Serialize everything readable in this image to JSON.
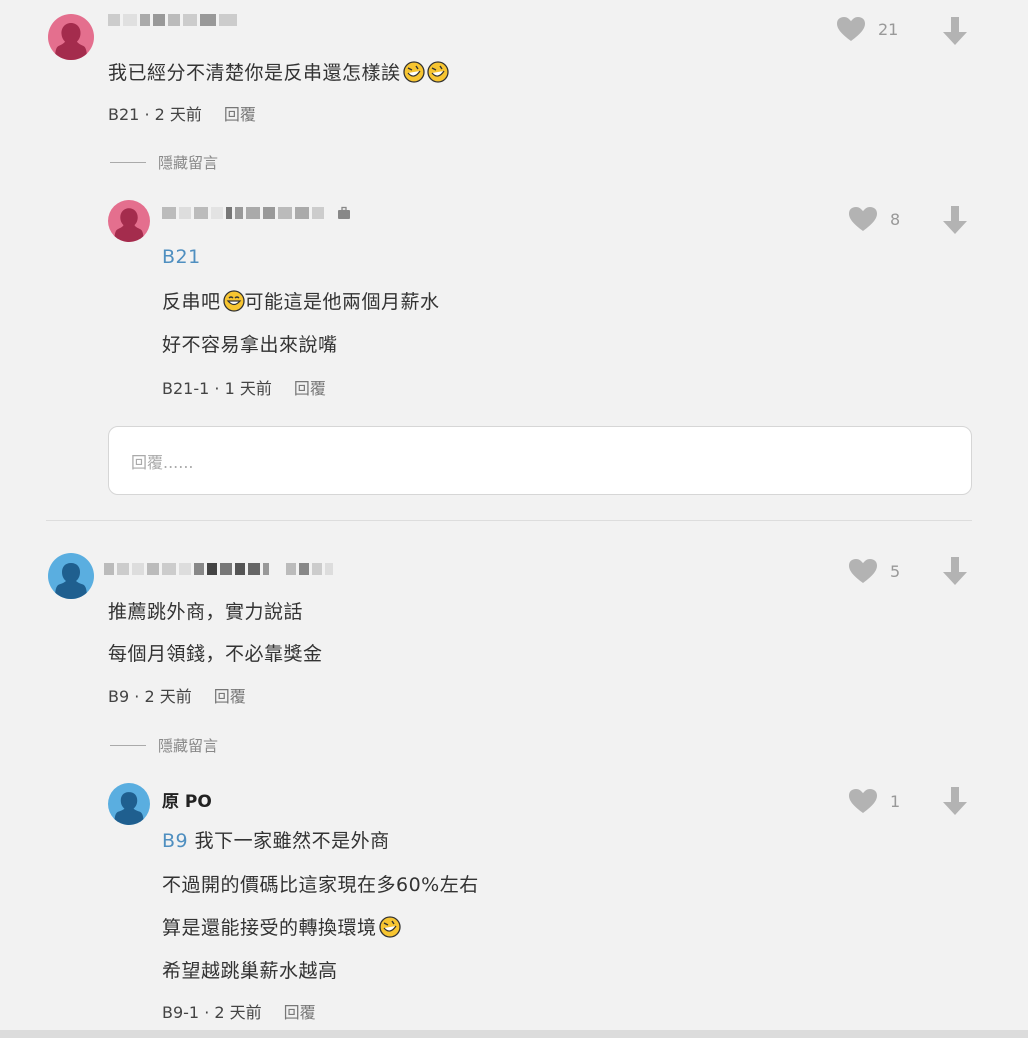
{
  "comments": [
    {
      "text_lines": [
        "我已經分不清楚你是反串還怎樣誒"
      ],
      "floor": "B21",
      "sep": "·",
      "time": "2 天前",
      "reply_label": "回覆",
      "likes": "21",
      "avatar_color": "#e46f8e",
      "hidden_label": "隱藏留言",
      "replies": [
        {
          "ref": "B21",
          "text_lines": [
            "反串吧",
            "可能這是他兩個月薪水",
            "好不容易拿出來說嘴"
          ],
          "floor": "B21-1",
          "sep": "·",
          "time": "1 天前",
          "reply_label": "回覆",
          "likes": "8",
          "avatar_color": "#e46f8e"
        }
      ],
      "reply_placeholder": "回覆......"
    },
    {
      "text_lines": [
        "推薦跳外商，實力說話",
        "每個月領錢，不必靠獎金"
      ],
      "floor": "B9",
      "sep": "·",
      "time": "2 天前",
      "reply_label": "回覆",
      "likes": "5",
      "avatar_color": "#5aaee0",
      "hidden_label": "隱藏留言",
      "replies": [
        {
          "author": "原 PO",
          "ref": "B9",
          "text_lines": [
            "我下一家雖然不是外商",
            "不過開的價碼比這家現在多60%左右",
            "算是還能接受的轉換環境",
            "希望越跳巢薪水越高"
          ],
          "floor": "B9-1",
          "sep": "·",
          "time": "2 天前",
          "reply_label": "回覆",
          "likes": "1",
          "avatar_color": "#5aaee0"
        }
      ]
    }
  ],
  "icons": {
    "like": "heart-icon",
    "dislike": "arrow-down-icon",
    "emoji_laugh": "rolling-laughing-emoji",
    "emoji_grin": "grinning-emoji",
    "badge": "briefcase-icon"
  },
  "colors": {
    "background": "#f2f2f2",
    "floor_link": "#4f8fc0",
    "icon_gray": "#b3b3b3",
    "female_avatar": "#e46f8e",
    "male_avatar": "#5aaee0"
  }
}
